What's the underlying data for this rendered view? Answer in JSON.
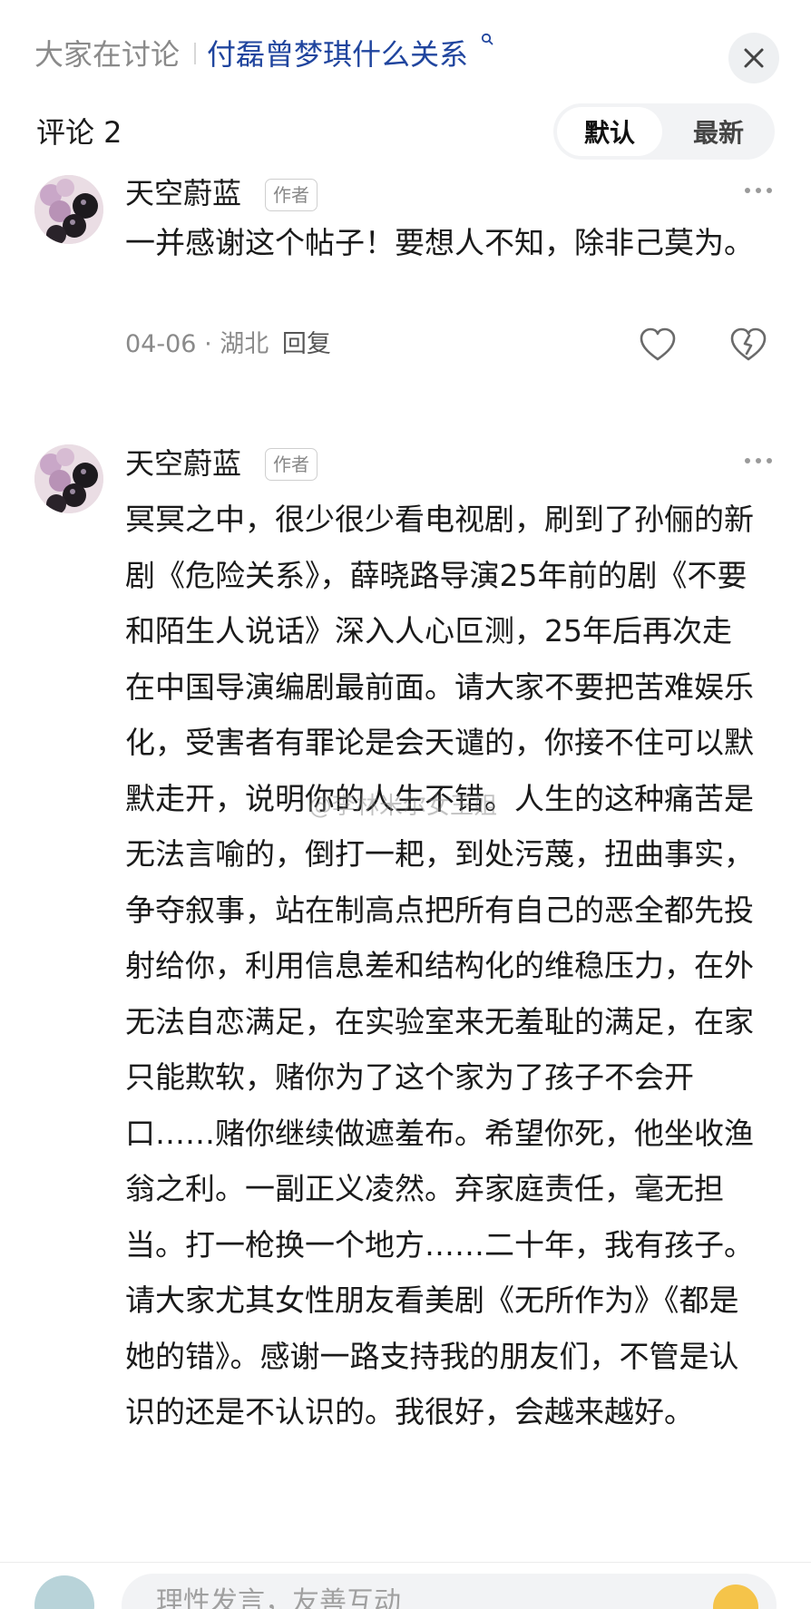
{
  "topbar": {
    "discussing_label": "大家在讨论",
    "topic": "付磊曾梦琪什么关系"
  },
  "comments_header": {
    "title": "评论 2",
    "sort_default": "默认",
    "sort_latest": "最新"
  },
  "comments": [
    {
      "author": "天空蔚蓝",
      "badge": "作者",
      "text": "一并感谢这个帖子！要想人不知，除非己莫为。",
      "date": "04-06",
      "location": "湖北",
      "reply_label": "回复"
    },
    {
      "author": "天空蔚蓝",
      "badge": "作者",
      "text": "冥冥之中，很少很少看电视剧，刷到了孙俪的新剧《危险关系》，薛晓路导演25年前的剧《不要和陌生人说话》深入人心叵测，25年后再次走在中国导演编剧最前面。请大家不要把苦难娱乐化，受害者有罪论是会天谴的，你接不住可以默默走开，说明你的人生不错。人生的这种痛苦是无法言喻的，倒打一耙，到处污蔑，扭曲事实，争夺叙事，站在制高点把所有自己的恶全都先投射给你，利用信息差和结构化的维稳压力，在外无法自恋满足，在实验室来无羞耻的满足，在家只能欺软，赌你为了这个家为了孩子不会开口……赌你继续做遮羞布。希望你死，他坐收渔翁之利。一副正义凌然。弃家庭责任，毫无担当。打一枪换一个地方……二十年，我有孩子。请大家尤其女性朋友看美剧《无所作为》《都是她的错》。感谢一路支持我的朋友们，不管是认识的还是不认识的。我很好，会越来越好。"
    }
  ],
  "watermark": "@李林米尔女王姐",
  "bottom_bar": {
    "input_placeholder": "理性发言，友善互动"
  },
  "colors": {
    "topic": "#20459e",
    "muted": "#8a8a8a",
    "pill_bg": "#f2f3f5"
  },
  "icons": [
    "search-icon",
    "close-icon",
    "more-icon",
    "like-icon",
    "dislike-icon",
    "emoji-icon"
  ]
}
